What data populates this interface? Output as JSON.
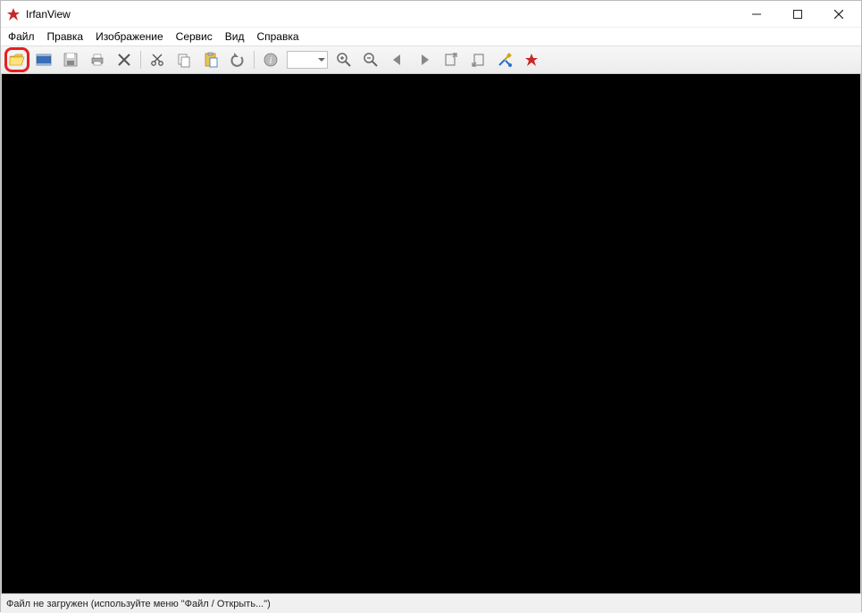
{
  "title": "IrfanView",
  "menu": {
    "file": "Файл",
    "edit": "Правка",
    "image": "Изображение",
    "service": "Сервис",
    "view": "Вид",
    "help": "Справка"
  },
  "toolbar": {
    "open": "open",
    "slideshow": "slideshow",
    "save": "save",
    "print": "print",
    "delete": "delete",
    "cut": "cut",
    "copy": "copy",
    "paste": "paste",
    "undo": "undo",
    "info": "info",
    "zoom_value": "",
    "zoom_in": "zoom-in",
    "zoom_out": "zoom-out",
    "prev": "prev",
    "next": "next",
    "prev_page": "prev-page",
    "next_page": "next-page",
    "settings": "settings",
    "about": "about"
  },
  "status": "Файл не загружен (используйте меню \"Файл / Открыть...\")"
}
